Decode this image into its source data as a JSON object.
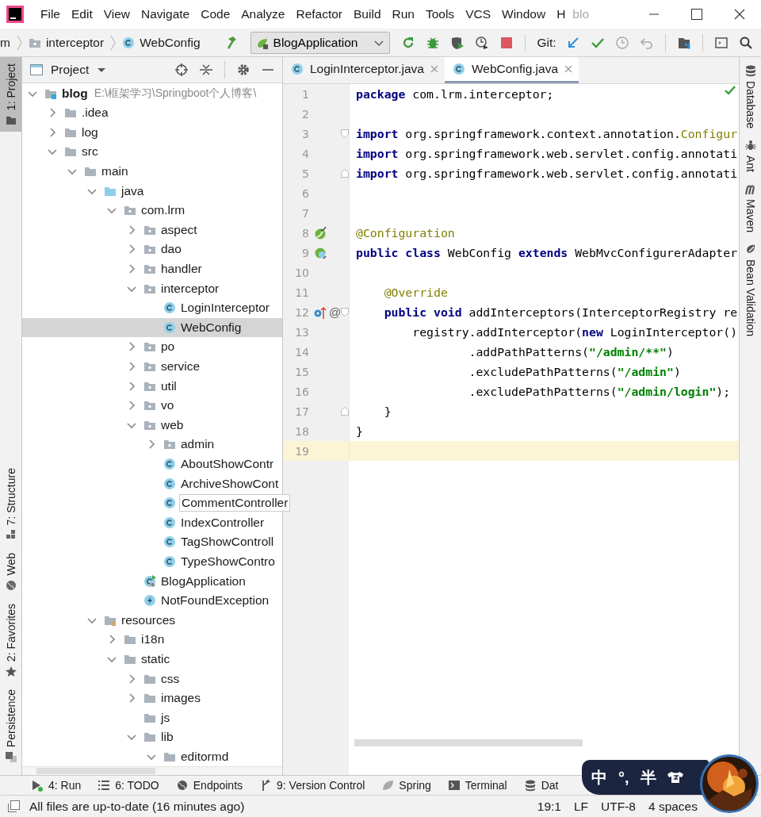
{
  "window": {
    "title": "blo",
    "menu": [
      "File",
      "Edit",
      "View",
      "Navigate",
      "Code",
      "Analyze",
      "Refactor",
      "Build",
      "Run",
      "Tools",
      "VCS",
      "Window",
      "H"
    ]
  },
  "nav_bar": {
    "breadcrumbs": [
      {
        "label": "m",
        "kind": "text"
      },
      {
        "label": "interceptor",
        "kind": "package"
      },
      {
        "label": "WebConfig",
        "kind": "class"
      }
    ],
    "run_config": "BlogApplication",
    "git_label": "Git:"
  },
  "left_tool_tabs": [
    {
      "label": "1: Project",
      "kind": "project",
      "selected": true
    },
    {
      "label": "7: Structure",
      "kind": "structure",
      "selected": false
    },
    {
      "label": "Web",
      "kind": "web",
      "selected": false
    },
    {
      "label": "2: Favorites",
      "kind": "favorites",
      "selected": false
    },
    {
      "label": "Persistence",
      "kind": "persistence",
      "selected": false
    }
  ],
  "project_panel": {
    "title": "Project",
    "tree": [
      {
        "label": "blog",
        "path": "E:\\框架学习\\Springboot个人博客\\",
        "kind": "module",
        "expanded": true,
        "selected": false,
        "children": [
          {
            "label": ".idea",
            "kind": "folder",
            "expanded": false,
            "selected": false
          },
          {
            "label": "log",
            "kind": "folder",
            "expanded": false,
            "selected": false
          },
          {
            "label": "src",
            "kind": "folder",
            "expanded": true,
            "selected": false,
            "children": [
              {
                "label": "main",
                "kind": "folder",
                "expanded": true,
                "selected": false,
                "children": [
                  {
                    "label": "java",
                    "kind": "source",
                    "expanded": true,
                    "selected": false,
                    "children": [
                      {
                        "label": "com.lrm",
                        "kind": "package",
                        "expanded": true,
                        "selected": false,
                        "children": [
                          {
                            "label": "aspect",
                            "kind": "package",
                            "expanded": false,
                            "selected": false
                          },
                          {
                            "label": "dao",
                            "kind": "package",
                            "expanded": false,
                            "selected": false
                          },
                          {
                            "label": "handler",
                            "kind": "package",
                            "expanded": false,
                            "selected": false
                          },
                          {
                            "label": "interceptor",
                            "kind": "package",
                            "expanded": true,
                            "selected": false,
                            "children": [
                              {
                                "label": "LoginInterceptor",
                                "kind": "class",
                                "selected": false
                              },
                              {
                                "label": "WebConfig",
                                "kind": "class",
                                "selected": true
                              }
                            ]
                          },
                          {
                            "label": "po",
                            "kind": "package",
                            "expanded": false,
                            "selected": false
                          },
                          {
                            "label": "service",
                            "kind": "package",
                            "expanded": false,
                            "selected": false
                          },
                          {
                            "label": "util",
                            "kind": "package",
                            "expanded": false,
                            "selected": false
                          },
                          {
                            "label": "vo",
                            "kind": "package",
                            "expanded": false,
                            "selected": false
                          },
                          {
                            "label": "web",
                            "kind": "package",
                            "expanded": true,
                            "selected": false,
                            "children": [
                              {
                                "label": "admin",
                                "kind": "package",
                                "expanded": false,
                                "selected": false
                              },
                              {
                                "label": "AboutShowContr",
                                "kind": "class",
                                "selected": false
                              },
                              {
                                "label": "ArchiveShowCont",
                                "kind": "class",
                                "selected": false
                              },
                              {
                                "label": "CommentController",
                                "kind": "class",
                                "selected": false,
                                "hovered": true
                              },
                              {
                                "label": "IndexController",
                                "kind": "class",
                                "selected": false
                              },
                              {
                                "label": "TagShowControll",
                                "kind": "class",
                                "selected": false
                              },
                              {
                                "label": "TypeShowContro",
                                "kind": "class",
                                "selected": false
                              }
                            ]
                          },
                          {
                            "label": "BlogApplication",
                            "kind": "app-class",
                            "selected": false
                          },
                          {
                            "label": "NotFoundException",
                            "kind": "exception",
                            "selected": false
                          }
                        ]
                      }
                    ]
                  },
                  {
                    "label": "resources",
                    "kind": "resource",
                    "expanded": true,
                    "selected": false,
                    "children": [
                      {
                        "label": "i18n",
                        "kind": "folder",
                        "expanded": false,
                        "selected": false
                      },
                      {
                        "label": "static",
                        "kind": "folder",
                        "expanded": true,
                        "selected": false,
                        "children": [
                          {
                            "label": "css",
                            "kind": "folder",
                            "expanded": false,
                            "selected": false
                          },
                          {
                            "label": "images",
                            "kind": "folder",
                            "expanded": false,
                            "selected": false
                          },
                          {
                            "label": "js",
                            "kind": "folder",
                            "selected": false
                          },
                          {
                            "label": "lib",
                            "kind": "folder",
                            "expanded": true,
                            "selected": false,
                            "children": [
                              {
                                "label": "editormd",
                                "kind": "folder",
                                "expanded": true,
                                "selected": false
                              }
                            ]
                          }
                        ]
                      }
                    ]
                  }
                ]
              }
            ]
          }
        ]
      }
    ]
  },
  "editor": {
    "tabs": [
      {
        "label": "LoginInterceptor.java",
        "selected": false
      },
      {
        "label": "WebConfig.java",
        "selected": true
      }
    ],
    "lines": [
      {
        "number": "1",
        "current": false,
        "tokens": [
          {
            "kind": "keyword",
            "text": "package"
          },
          {
            "kind": "plain",
            "text": " com.lrm.interceptor;"
          }
        ]
      },
      {
        "number": "2",
        "current": false
      },
      {
        "number": "3",
        "current": false,
        "fold_start": true,
        "tokens": [
          {
            "kind": "keyword",
            "text": "import"
          },
          {
            "kind": "plain",
            "text": " org.springframework.context.annotation."
          },
          {
            "kind": "annotation",
            "text": "Configur"
          }
        ]
      },
      {
        "number": "4",
        "current": false,
        "tokens": [
          {
            "kind": "keyword",
            "text": "import"
          },
          {
            "kind": "plain",
            "text": " org.springframework.web.servlet.config.annotati"
          }
        ]
      },
      {
        "number": "5",
        "current": false,
        "fold_end": true,
        "tokens": [
          {
            "kind": "keyword",
            "text": "import"
          },
          {
            "kind": "plain",
            "text": " org.springframework.web.servlet.config.annotati"
          }
        ]
      },
      {
        "number": "6",
        "current": false
      },
      {
        "number": "7",
        "current": false
      },
      {
        "number": "8",
        "current": false,
        "markers": [
          {
            "kind": "bean"
          }
        ],
        "tokens": [
          {
            "kind": "annotation",
            "text": "@Configuration"
          }
        ]
      },
      {
        "number": "9",
        "current": false,
        "markers": [
          {
            "kind": "bean-class"
          }
        ],
        "tokens": [
          {
            "kind": "keyword",
            "text": "public"
          },
          {
            "kind": "keyword",
            "text": " class"
          },
          {
            "kind": "plain",
            "text": " WebConfig "
          },
          {
            "kind": "keyword",
            "text": "extends"
          },
          {
            "kind": "plain",
            "text": " WebMvcConfigurerAdapter"
          }
        ]
      },
      {
        "number": "10",
        "current": false
      },
      {
        "number": "11",
        "current": false,
        "tokens": [
          {
            "kind": "annotation",
            "text": "    @Override"
          }
        ]
      },
      {
        "number": "12",
        "current": false,
        "fold_start": true,
        "markers": [
          {
            "kind": "override"
          },
          {
            "kind": "symbol",
            "text": "@"
          }
        ],
        "tokens": [
          {
            "kind": "keyword",
            "text": "    public"
          },
          {
            "kind": "keyword",
            "text": " void"
          },
          {
            "kind": "plain",
            "text": " addInterceptors(InterceptorRegistry re"
          }
        ]
      },
      {
        "number": "13",
        "current": false,
        "tokens": [
          {
            "kind": "plain",
            "text": "        registry.addInterceptor("
          },
          {
            "kind": "keyword",
            "text": "new"
          },
          {
            "kind": "plain",
            "text": " LoginInterceptor()"
          }
        ]
      },
      {
        "number": "14",
        "current": false,
        "tokens": [
          {
            "kind": "plain",
            "text": "                .addPathPatterns("
          },
          {
            "kind": "string",
            "text": "\"/admin/**\""
          },
          {
            "kind": "plain",
            "text": ")"
          }
        ]
      },
      {
        "number": "15",
        "current": false,
        "tokens": [
          {
            "kind": "plain",
            "text": "                .excludePathPatterns("
          },
          {
            "kind": "string",
            "text": "\"/admin\""
          },
          {
            "kind": "plain",
            "text": ")"
          }
        ]
      },
      {
        "number": "16",
        "current": false,
        "tokens": [
          {
            "kind": "plain",
            "text": "                .excludePathPatterns("
          },
          {
            "kind": "string",
            "text": "\"/admin/login\""
          },
          {
            "kind": "plain",
            "text": ");"
          }
        ]
      },
      {
        "number": "17",
        "current": false,
        "fold_end": true,
        "tokens": [
          {
            "kind": "plain",
            "text": "    }"
          }
        ]
      },
      {
        "number": "18",
        "current": false,
        "tokens": [
          {
            "kind": "plain",
            "text": "}"
          }
        ]
      },
      {
        "number": "19",
        "current": true
      }
    ]
  },
  "right_tool_tabs": [
    {
      "label": "Database",
      "kind": "database"
    },
    {
      "label": "Ant",
      "kind": "ant"
    },
    {
      "label": "Maven",
      "kind": "maven"
    },
    {
      "label": "Bean Validation",
      "kind": "bean"
    }
  ],
  "bottom_tools": [
    {
      "label": "4: Run",
      "kind": "run"
    },
    {
      "label": "6: TODO",
      "kind": "todo"
    },
    {
      "label": "Endpoints",
      "kind": "endpoints"
    },
    {
      "label": "9: Version Control",
      "kind": "vcs"
    },
    {
      "label": "Spring",
      "kind": "spring"
    },
    {
      "label": "Terminal",
      "kind": "terminal"
    },
    {
      "label": "Dat",
      "kind": "database"
    }
  ],
  "status_bar": {
    "message": "All files are up-to-date (16 minutes ago)",
    "items": [
      "19:1",
      "LF",
      "UTF-8",
      "4 spaces"
    ]
  },
  "ime_bar": {
    "items": [
      "中",
      "°,",
      "半"
    ],
    "avatar": {
      "kind": "picture"
    }
  }
}
